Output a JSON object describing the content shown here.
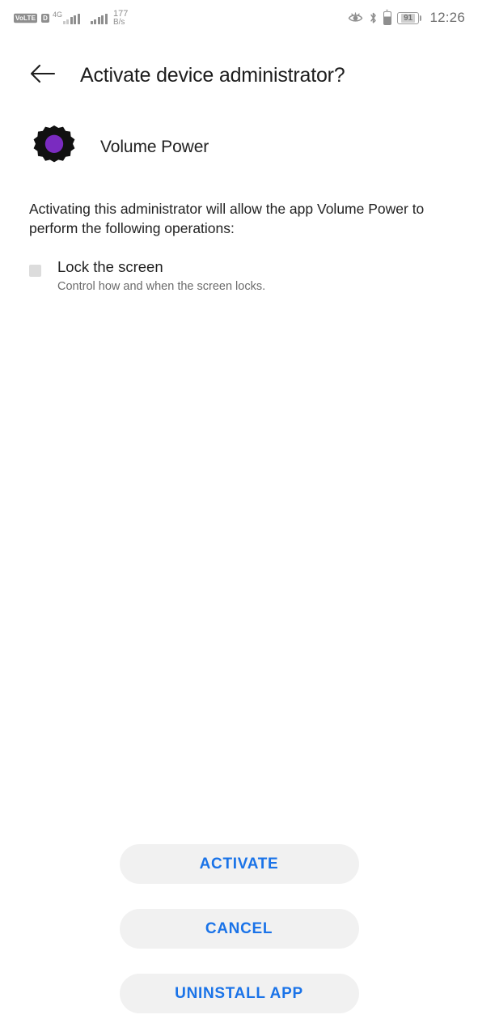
{
  "status_bar": {
    "volte_label": "VoLTE",
    "data_indicator": "D",
    "network_type": "4G",
    "net_speed_value": "177",
    "net_speed_unit": "B/s",
    "eye_comfort_icon": "eye-icon",
    "bluetooth_icon": "bluetooth-icon",
    "vibrate_battery_icon": "battery-small-icon",
    "battery_percent": "91",
    "time": "12:26"
  },
  "app_bar": {
    "back_icon": "back-arrow-icon",
    "title": "Activate device administrator?"
  },
  "app": {
    "icon": "gear-icon",
    "name": "Volume Power",
    "icon_colors": {
      "gear": "#111111",
      "center": "#7A2BC0"
    }
  },
  "description": "Activating this administrator will allow the app Volume Power to perform the following operations:",
  "policies": [
    {
      "title": "Lock the screen",
      "description": "Control how and when the screen locks."
    }
  ],
  "buttons": {
    "activate": "ACTIVATE",
    "cancel": "CANCEL",
    "uninstall": "UNINSTALL APP",
    "text_color": "#1a73e8",
    "background_color": "#f1f1f1"
  }
}
